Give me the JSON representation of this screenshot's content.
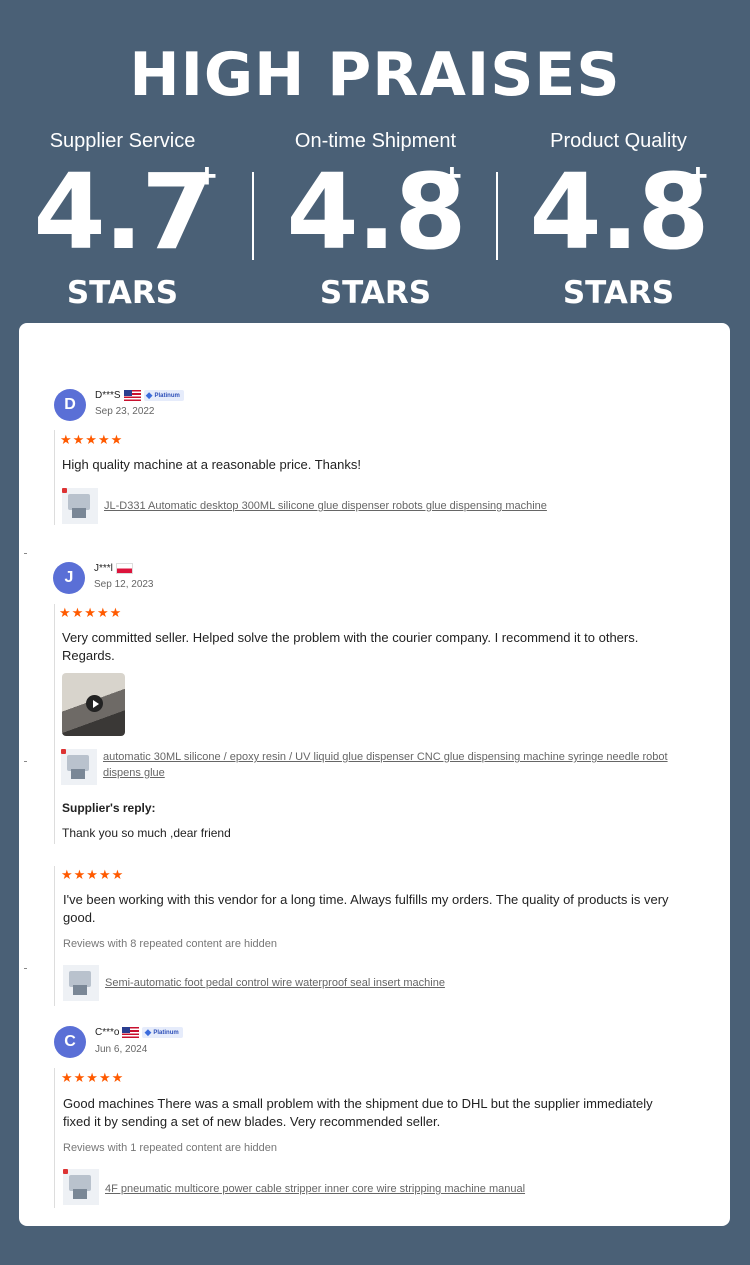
{
  "headline": "HIGH PRAISES",
  "stats": [
    {
      "label": "Supplier Service",
      "value": "4.7",
      "plus": "+",
      "unit": "STARS"
    },
    {
      "label": "On-time Shipment",
      "value": "4.8",
      "plus": "+",
      "unit": "STARS"
    },
    {
      "label": "Product Quality",
      "value": "4.8",
      "plus": "+",
      "unit": "STARS"
    }
  ],
  "colors": {
    "background": "#4a6076",
    "star": "#ff5a00",
    "avatar": "#5a6fd6"
  },
  "reviews": [
    {
      "initial": "D",
      "user": "D***S",
      "flag": "flag-us-icon",
      "badge": "Platinum",
      "date": "Sep 23, 2022",
      "stars": "★★★★★",
      "text": "High quality machine at a reasonable price. Thanks!",
      "product": "JL-D331 Automatic desktop 300ML silicone glue dispenser robots glue dispensing machine"
    },
    {
      "initial": "J",
      "user": "J***l",
      "flag": "flag-pl-icon",
      "date": "Sep 12, 2023",
      "stars": "★★★★★",
      "text": "Very committed seller. Helped solve the problem with the courier company. I recommend it to others. Regards.",
      "product": "automatic 30ML silicone / epoxy resin / UV liquid glue dispenser CNC glue dispensing machine syringe needle robot dispens glue",
      "reply_title": "Supplier's reply:",
      "reply_text": "Thank you so much ,dear friend"
    },
    {
      "stars": "★★★★★",
      "text": "I've been working with this vendor for a long time. Always fulfills my orders. The quality of products is very good.",
      "hidden_note": "Reviews with 8 repeated content are hidden",
      "product": "Semi-automatic foot pedal control wire waterproof seal insert machine"
    },
    {
      "initial": "C",
      "user": "C***o",
      "flag": "flag-us-icon",
      "badge": "Platinum",
      "date": "Jun 6, 2024",
      "stars": "★★★★★",
      "text": "Good machines There was a small problem with the shipment due to DHL but the supplier immediately fixed it by sending a set of new blades. Very recommended seller.",
      "hidden_note": "Reviews with 1 repeated content are hidden",
      "product": "4F pneumatic multicore power cable stripper inner core wire stripping machine manual"
    }
  ]
}
